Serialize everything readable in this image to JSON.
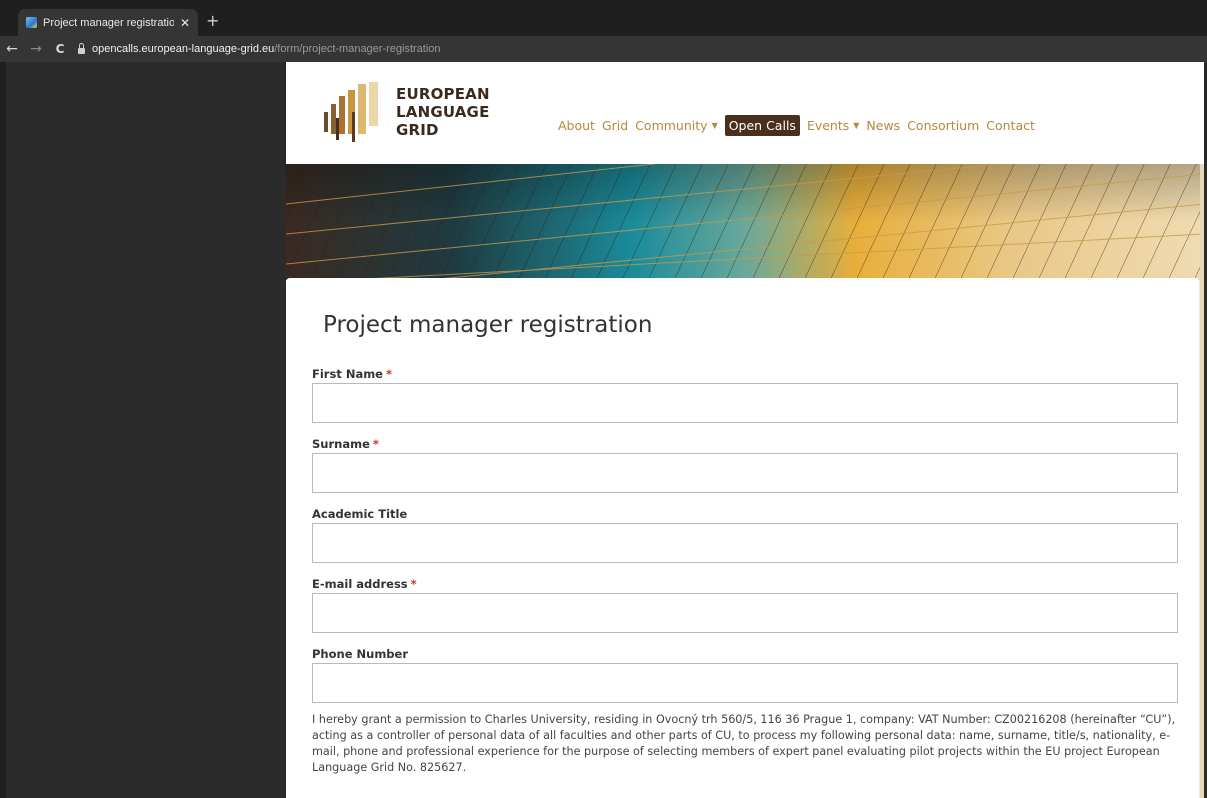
{
  "browser": {
    "tab_title": "Project manager registration | EL",
    "tab_close": "✕",
    "new_tab": "+",
    "back": "←",
    "forward": "→",
    "reload": "C",
    "url_host": "opencalls.european-language-grid.eu",
    "url_path": "/form/project-manager-registration"
  },
  "header": {
    "logo_lines": [
      "EUROPEAN",
      "LANGUAGE",
      "GRID"
    ],
    "nav": [
      {
        "label": "About"
      },
      {
        "label": "Grid"
      },
      {
        "label": "Community",
        "caret": "▼"
      },
      {
        "label": "Open Calls"
      },
      {
        "label": "Events",
        "caret": "▼"
      },
      {
        "label": "News"
      },
      {
        "label": "Consortium"
      },
      {
        "label": "Contact"
      }
    ]
  },
  "form": {
    "title": "Project manager registration",
    "required_mark": "*",
    "fields": [
      {
        "label": "First Name",
        "value": "",
        "required": true
      },
      {
        "label": "Surname",
        "value": "",
        "required": true
      },
      {
        "label": "Academic Title",
        "value": "",
        "required": false
      },
      {
        "label": "E-mail address",
        "value": "",
        "required": true
      },
      {
        "label": "Phone Number",
        "value": "",
        "required": false
      }
    ],
    "consent_text": "I hereby grant a permission to Charles University, residing in Ovocný trh 560/5, 116 36 Prague 1, company: VAT Number: CZ00216208 (hereinafter “CU”), acting as a controller of personal data of all faculties and other parts of CU, to process my following personal data: name, surname, title/s, nationality, e-mail, phone and professional experience for the purpose of selecting members of expert panel evaluating pilot projects within the EU project European Language Grid No. 825627."
  },
  "colors": {
    "nav_link": "#b5893b",
    "nav_active_bg": "#4a2f1c",
    "required": "#c0392b",
    "logo_text": "#3a2a1c"
  }
}
